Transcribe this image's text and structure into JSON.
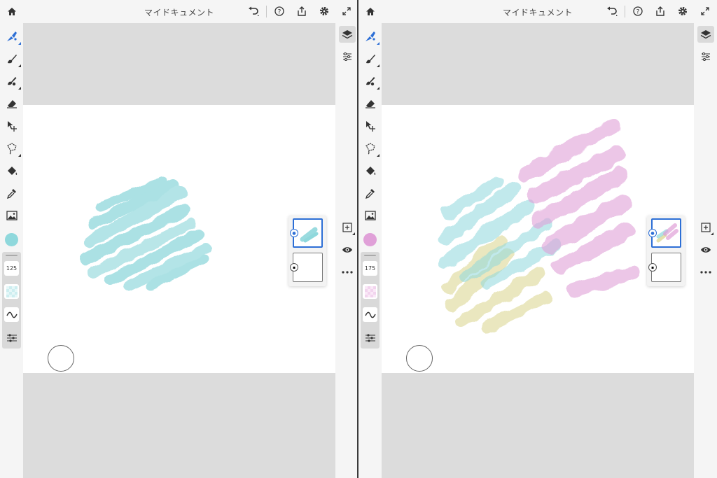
{
  "document": {
    "title": "マイドキュメント"
  },
  "panes": [
    {
      "id": "left",
      "title": "マイドキュメント",
      "brush_size": "125",
      "active_color": "#8fd8dc",
      "paint_color": "#8fd8dc",
      "icons": {
        "home": "home-icon",
        "undo": "undo-icon",
        "help": "help-icon",
        "share": "share-icon",
        "settings": "gear-icon",
        "fullscreen": "fullscreen-icon"
      }
    },
    {
      "id": "right",
      "title": "マイドキュメント",
      "brush_size": "175",
      "active_color": "#e0a0d8",
      "paint_color": "#e0a0d8",
      "icons": {
        "home": "home-icon",
        "undo": "undo-icon",
        "help": "help-icon",
        "share": "share-icon",
        "settings": "gear-icon",
        "fullscreen": "fullscreen-icon"
      }
    }
  ],
  "left_tools": [
    "watercolor-brush-icon",
    "brush-icon",
    "paint-brush-icon",
    "eraser-icon",
    "move-icon",
    "lasso-icon",
    "fill-icon",
    "eyedropper-icon",
    "image-icon"
  ],
  "right_tools": [
    "layers-icon",
    "adjustments-icon",
    "add-layer-icon",
    "visibility-icon",
    "more-icon"
  ],
  "colors": {
    "accent_blue": "#2d6fd6",
    "toolbar_bg": "#f5f5f5",
    "background": "#dcdcdc"
  }
}
